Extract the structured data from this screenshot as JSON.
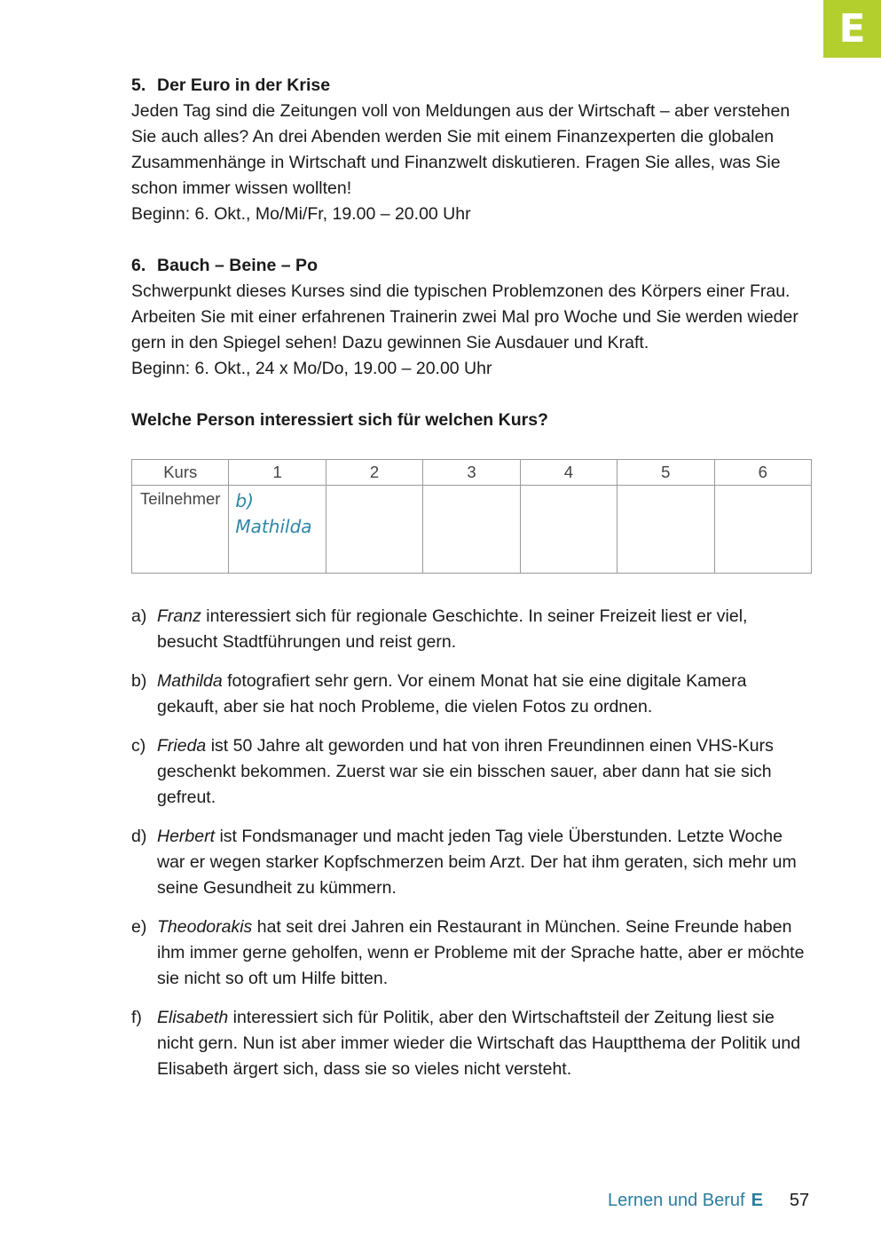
{
  "tab_letter": "E",
  "courses": [
    {
      "number": "5.",
      "title": "Der Euro in der Krise",
      "lines": [
        "Jeden Tag sind die Zeitungen voll von Meldungen aus der Wirtschaft – aber verstehen",
        "Sie auch alles? An drei Abenden werden Sie mit einem Finanzexperten die globalen",
        "Zusammenhänge in Wirtschaft und Finanzwelt diskutieren. Fragen Sie alles, was Sie",
        "schon immer wissen wollten!",
        "Beginn: 6. Okt., Mo/Mi/Fr, 19.00 – 20.00 Uhr"
      ]
    },
    {
      "number": "6.",
      "title": "Bauch – Beine – Po",
      "lines": [
        "Schwerpunkt dieses Kurses sind die typischen Problemzonen des Körpers einer Frau.",
        "Arbeiten Sie mit einer erfahrenen Trainerin zwei Mal pro Woche und Sie werden wieder",
        "gern in den Spiegel sehen! Dazu gewinnen Sie Ausdauer und Kraft.",
        "Beginn: 6. Okt., 24 x Mo/Do, 19.00 – 20.00 Uhr"
      ]
    }
  ],
  "question": "Welche Person interessiert sich für welchen Kurs?",
  "table": {
    "header_label": "Kurs",
    "columns": [
      "1",
      "2",
      "3",
      "4",
      "5",
      "6"
    ],
    "row_label": "Teilnehmer",
    "answers": [
      "b)\nMathilda",
      "",
      "",
      "",
      "",
      ""
    ]
  },
  "persons": [
    {
      "letter": "a)",
      "name": "Franz",
      "lines": [
        " interessiert sich für regionale Geschichte. In seiner Freizeit liest er viel,",
        "besucht Stadtführungen und reist gern."
      ]
    },
    {
      "letter": "b)",
      "name": "Mathilda",
      "lines": [
        " fotografiert sehr gern. Vor einem Monat hat sie eine digitale Kamera",
        "gekauft, aber sie hat noch Probleme, die vielen Fotos zu ordnen."
      ]
    },
    {
      "letter": "c)",
      "name": "Frieda",
      "lines": [
        " ist 50 Jahre alt geworden und hat von ihren Freundinnen einen VHS-Kurs",
        "geschenkt bekommen. Zuerst war sie ein bisschen sauer, aber dann hat sie sich",
        "gefreut."
      ]
    },
    {
      "letter": "d)",
      "name": "Herbert",
      "lines": [
        " ist Fondsmanager und macht jeden Tag viele Überstunden. Letzte Woche",
        "war er wegen starker Kopfschmerzen beim Arzt. Der hat ihm geraten, sich mehr um",
        "seine Gesundheit zu kümmern."
      ]
    },
    {
      "letter": "e)",
      "name": "Theodorakis",
      "lines": [
        " hat seit drei Jahren ein Restaurant in München. Seine Freunde haben",
        "ihm immer gerne geholfen, wenn er Probleme mit der Sprache hatte, aber er möchte",
        "sie nicht so oft um Hilfe bitten."
      ]
    },
    {
      "letter": "f)",
      "name": "Elisabeth",
      "lines": [
        " interessiert sich für Politik, aber den Wirtschaftsteil der Zeitung liest sie",
        "nicht gern. Nun ist aber immer wieder die Wirtschaft das Hauptthema der Politik und",
        "Elisabeth ärgert sich, dass sie so vieles nicht versteht."
      ]
    }
  ],
  "footer": {
    "section": "Lernen und Beruf",
    "letter": "E",
    "page_number": "57"
  },
  "colors": {
    "tab": "#b3cf2e",
    "footer_text": "#2b7d9e",
    "handwriting": "#2e86a7"
  }
}
